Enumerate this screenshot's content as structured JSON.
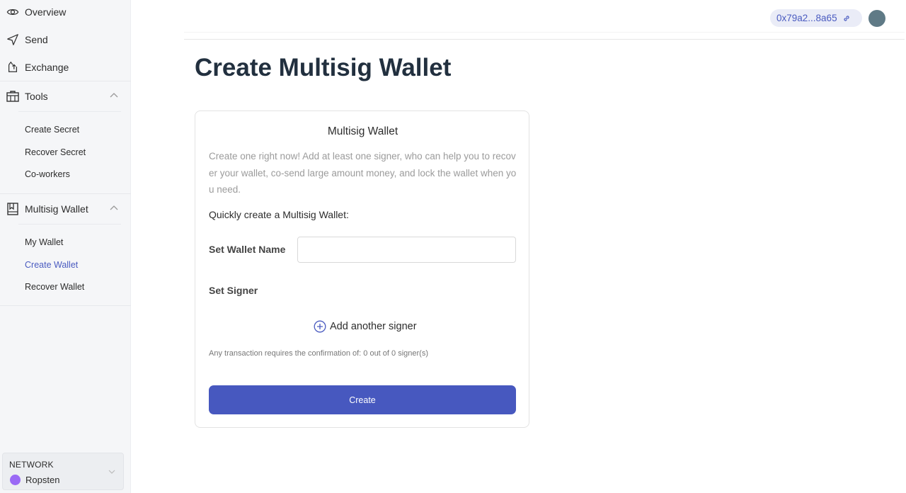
{
  "sidebar": {
    "nav": [
      {
        "label": "Overview",
        "icon": "eye-icon"
      },
      {
        "label": "Send",
        "icon": "send-icon"
      },
      {
        "label": "Exchange",
        "icon": "exchange-icon"
      }
    ],
    "tools": {
      "label": "Tools",
      "icon": "toolbox-icon",
      "items": [
        "Create Secret",
        "Recover Secret",
        "Co-workers"
      ]
    },
    "multisig": {
      "label": "Multisig Wallet",
      "icon": "wallet-book-icon",
      "items": [
        "My Wallet",
        "Create Wallet",
        "Recover Wallet"
      ],
      "active_item": "Create Wallet"
    },
    "network": {
      "label": "NETWORK",
      "name": "Ropsten",
      "dot_color": "#9a69f5"
    }
  },
  "header": {
    "address": "0x79a2...8a65",
    "avatar_color": "#5f7a86"
  },
  "main": {
    "title": "Create Multisig Wallet",
    "card": {
      "title": "Multisig Wallet",
      "description": "Create one right now! Add at least one signer, who can help you to recover your wallet, co-send large amount money, and lock the wallet when you need.",
      "quick_label": "Quickly create a Multisig Wallet:",
      "wallet_name_label": "Set Wallet Name",
      "wallet_name_value": "",
      "signer_label": "Set Signer",
      "add_signer_label": "Add another signer",
      "confirmation_text": "Any transaction requires the confirmation of: 0 out of 0 signer(s)",
      "create_button": "Create"
    }
  },
  "colors": {
    "accent": "#4758bf",
    "sidebar_bg": "#f5f6f8",
    "title": "#22303f"
  }
}
